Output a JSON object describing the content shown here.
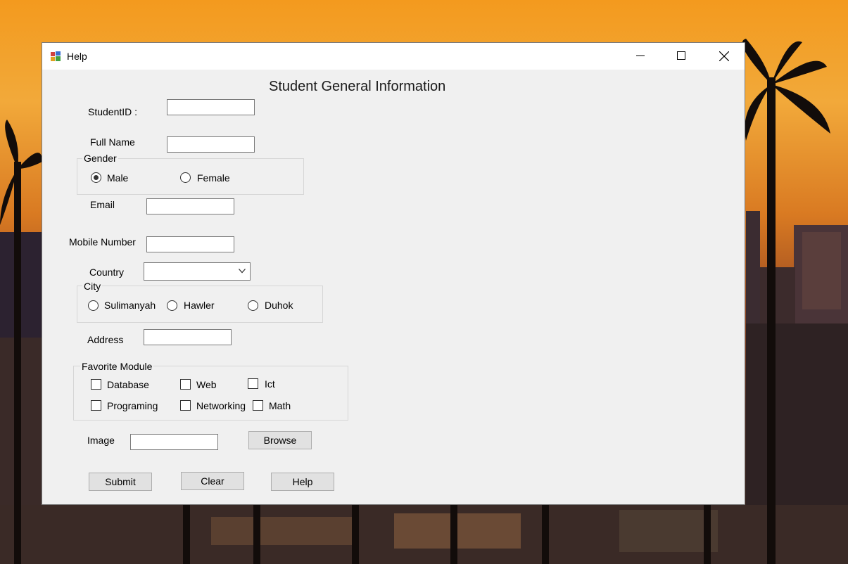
{
  "window": {
    "title": "Help",
    "controls": {
      "minimize": "minimize-icon",
      "maximize": "maximize-icon",
      "close": "close-icon"
    }
  },
  "form": {
    "heading": "Student General Information",
    "student_id": {
      "label": "StudentID :",
      "value": ""
    },
    "full_name": {
      "label": "Full Name",
      "value": ""
    },
    "gender": {
      "title": "Gender",
      "options": [
        {
          "label": "Male",
          "checked": true
        },
        {
          "label": "Female",
          "checked": false
        }
      ]
    },
    "email": {
      "label": "Email",
      "value": ""
    },
    "mobile": {
      "label": "Mobile Number",
      "value": ""
    },
    "country": {
      "label": "Country",
      "value": ""
    },
    "city": {
      "title": "City",
      "options": [
        {
          "label": "Sulimanyah",
          "checked": false
        },
        {
          "label": "Hawler",
          "checked": false
        },
        {
          "label": "Duhok",
          "checked": false
        }
      ]
    },
    "address": {
      "label": "Address",
      "value": ""
    },
    "favorite_module": {
      "title": "Favorite Module",
      "options": [
        {
          "label": "Database",
          "checked": false
        },
        {
          "label": "Web",
          "checked": false
        },
        {
          "label": "Ict",
          "checked": false
        },
        {
          "label": "Programing",
          "checked": false
        },
        {
          "label": "Networking",
          "checked": false
        },
        {
          "label": "Math",
          "checked": false
        }
      ]
    },
    "image": {
      "label": "Image",
      "value": "",
      "browse_label": "Browse"
    },
    "buttons": {
      "submit": "Submit",
      "clear": "Clear",
      "help": "Help"
    }
  }
}
